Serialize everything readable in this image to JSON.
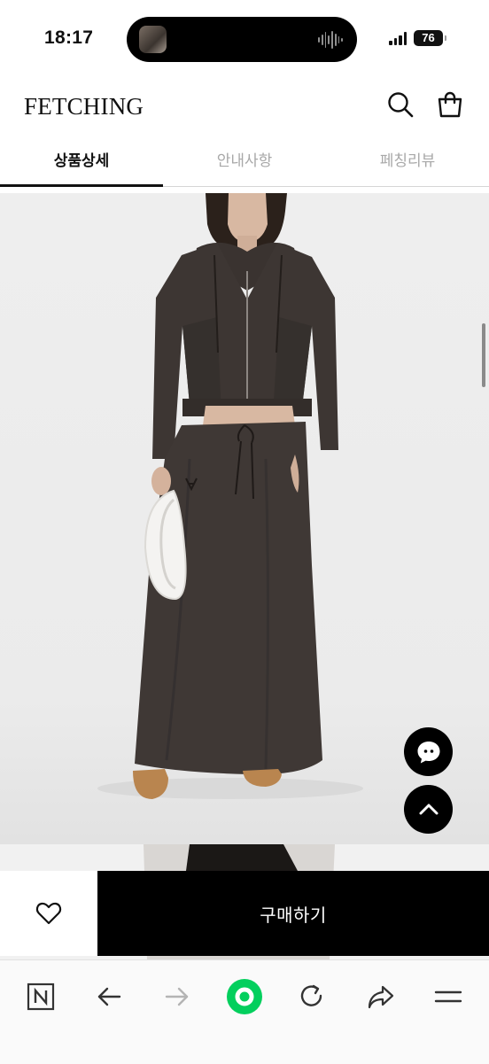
{
  "status_bar": {
    "time": "18:17",
    "battery": "76"
  },
  "header": {
    "brand": "FETCHING",
    "icons": [
      "search-icon",
      "shopping-bag-icon"
    ]
  },
  "tabs": [
    {
      "label": "상품상세",
      "active": true
    },
    {
      "label": "안내사항",
      "active": false
    },
    {
      "label": "페칭리뷰",
      "active": false
    }
  ],
  "floating_buttons": [
    "chat-icon",
    "arrow-up-icon"
  ],
  "purchase_bar": {
    "buy_label": "구매하기",
    "wishlist_icon": "heart-icon"
  },
  "browser_toolbar": {
    "icons": [
      "naver-icon",
      "back-arrow-icon",
      "forward-arrow-icon",
      "green-dot-icon",
      "refresh-icon",
      "share-icon",
      "menu-icon"
    ]
  },
  "colors": {
    "accent": "#000000",
    "browser_green": "#03cf5d",
    "tab_inactive": "#a8a8a8",
    "garment": "#3d3633"
  }
}
